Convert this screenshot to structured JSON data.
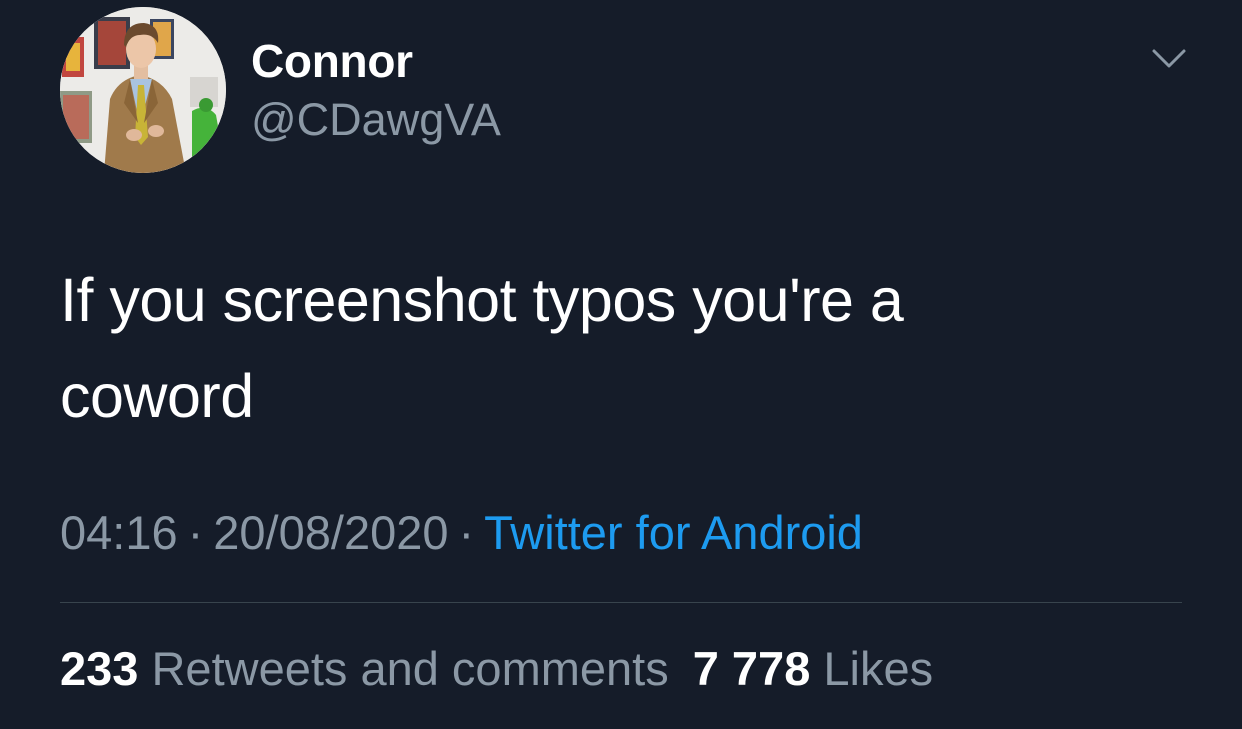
{
  "tweet": {
    "author": {
      "display_name": "Connor",
      "handle": "@CDawgVA"
    },
    "text_line1": "If you screenshot typos you're a",
    "text_line2": "coword",
    "time": "04:16",
    "date": "20/08/2020",
    "separator": "·",
    "source": "Twitter for Android",
    "retweets_count": "233",
    "retweets_label": "Retweets and comments",
    "likes_count": "7 778",
    "likes_label": "Likes"
  },
  "icons": {
    "menu": "chevron-down-icon",
    "avatar": "profile-photo"
  },
  "colors": {
    "background": "#151c29",
    "primary_text": "#ffffff",
    "secondary_text": "#8b98a5",
    "link": "#1d9bf0",
    "divider": "#38444d"
  }
}
